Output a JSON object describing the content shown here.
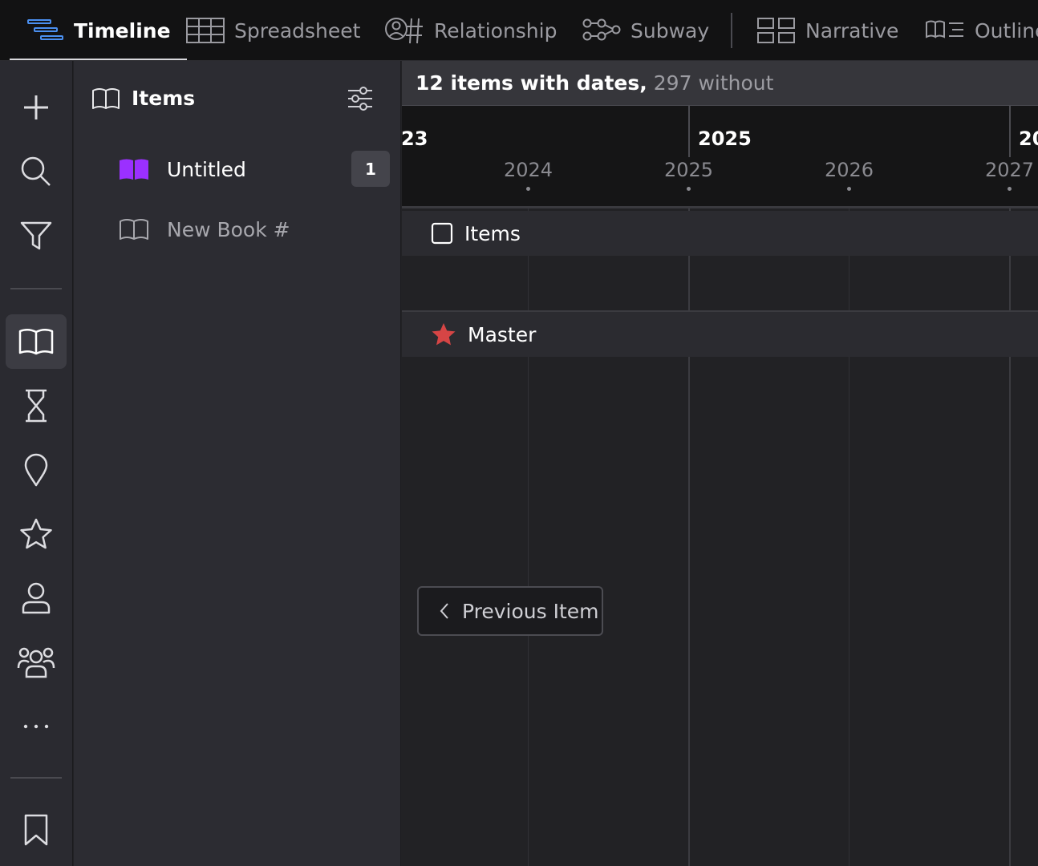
{
  "tabs": [
    {
      "label": "Timeline",
      "icon": "timeline-icon",
      "active": true
    },
    {
      "label": "Spreadsheet",
      "icon": "spreadsheet-icon"
    },
    {
      "label": "Relationship",
      "icon": "relationship-icon"
    },
    {
      "label": "Subway",
      "icon": "subway-icon"
    },
    {
      "label": "Narrative",
      "icon": "narrative-icon"
    },
    {
      "label": "Outline",
      "icon": "outline-icon"
    }
  ],
  "rail": {
    "icons": [
      "plus-icon",
      "search-icon",
      "filter-icon",
      "book-icon",
      "hourglass-icon",
      "location-pin-icon",
      "star-icon",
      "person-icon",
      "group-icon",
      "more-icon",
      "bookmark-icon"
    ],
    "selected": "book-icon"
  },
  "panel": {
    "title": "Items",
    "books": [
      {
        "label": "Untitled",
        "count": "1",
        "color": "#9b30ff"
      },
      {
        "label": "New Book #"
      }
    ]
  },
  "timeline": {
    "summary_dated": "12 items with dates,",
    "summary_undated": "297 without",
    "major_ticks": [
      "23",
      "2025",
      "20"
    ],
    "minor_ticks": [
      "2024",
      "2025",
      "2026",
      "2027"
    ],
    "bands": [
      {
        "label": "Items",
        "icon": "checkbox-icon"
      },
      {
        "label": "Master",
        "icon": "star-icon",
        "icon_color": "#d64545"
      }
    ],
    "prev_button": "Previous Item"
  },
  "colors": {
    "accent": "#9b30ff",
    "tab_accent": "#4a8ff0",
    "star": "#d64545"
  }
}
